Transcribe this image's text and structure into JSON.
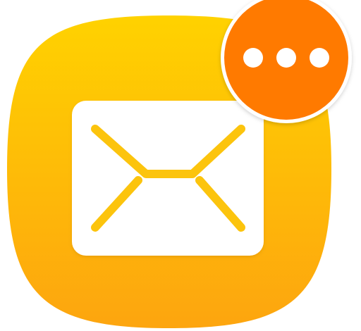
{
  "app_icon": {
    "icon": "mail-icon",
    "colors": {
      "background_top": "#FFD200",
      "background_bottom": "#FDA50F",
      "envelope_body": "#FFFFFF",
      "envelope_lines": "#FCC40E"
    }
  },
  "badge": {
    "icon": "more-dots-icon",
    "dot_count": 3,
    "colors": {
      "fill": "#FF7A00",
      "ring": "#FFFFFF",
      "dots": "#FFFFFF"
    }
  }
}
